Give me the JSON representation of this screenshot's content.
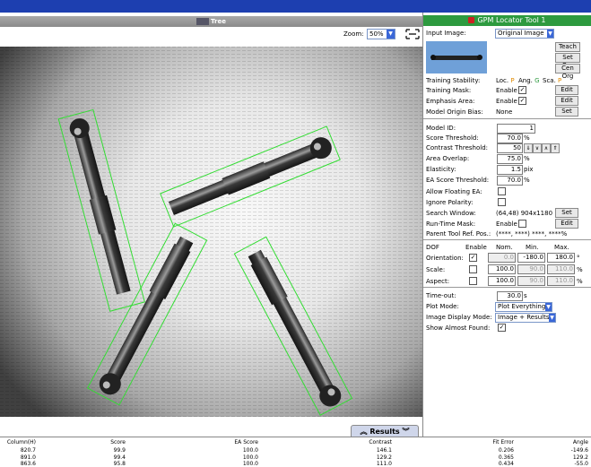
{
  "tree": {
    "title": "Tree"
  },
  "zoom": {
    "label": "Zoom:",
    "value": "50%"
  },
  "tool": {
    "title": "GPM Locator Tool 1"
  },
  "input_image": {
    "label": "Input Image:",
    "value": "Original Image"
  },
  "buttons": {
    "teach": "Teach",
    "set_org": "Set Org",
    "cen_org": "Cen Org"
  },
  "stability": {
    "label": "Training Stability:",
    "loc": "Loc.",
    "loc_v": "P",
    "ang": "Ang.",
    "ang_v": "G",
    "sca": "Sca.",
    "sca_v": "P"
  },
  "training_mask": {
    "label": "Training Mask:",
    "enable": "Enable",
    "button": "Edit"
  },
  "emphasis": {
    "label": "Emphasis Area:",
    "enable": "Enable",
    "button": "Edit"
  },
  "origin_bias": {
    "label": "Model Origin Bias:",
    "value": "None",
    "button": "Set"
  },
  "model_id": {
    "label": "Model ID:",
    "value": "1"
  },
  "score_thr": {
    "label": "Score Threshold:",
    "value": "70.0",
    "unit": "%"
  },
  "contrast_thr": {
    "label": "Contrast Threshold:",
    "value": "50"
  },
  "area_overlap": {
    "label": "Area Overlap:",
    "value": "75.0",
    "unit": "%"
  },
  "elasticity": {
    "label": "Elasticity:",
    "value": "1.5",
    "unit": "pix"
  },
  "ea_score": {
    "label": "EA Score Threshold:",
    "value": "70.0",
    "unit": "%"
  },
  "floating_ea": {
    "label": "Allow Floating EA:"
  },
  "ignore_pol": {
    "label": "Ignore Polarity:"
  },
  "search_window": {
    "label": "Search Window:",
    "value": "(64,48) 904x1180",
    "button": "Set"
  },
  "runtime_mask": {
    "label": "Run-Time Mask:",
    "enable": "Enable",
    "button": "Edit"
  },
  "parent_ref": {
    "label": "Parent Tool Ref. Pos.:",
    "value": "(****, ****) ****, ****%"
  },
  "dof": {
    "header": {
      "dof": "DOF",
      "enable": "Enable",
      "nom": "Nom.",
      "min": "Min.",
      "max": "Max."
    },
    "rows": [
      {
        "label": "Orientation:",
        "checked": "✓",
        "nom": "0.0",
        "min": "-180.0",
        "max": "180.0",
        "unit": "°"
      },
      {
        "label": "Scale:",
        "checked": "",
        "nom": "100.0",
        "min": "90.0",
        "max": "110.0",
        "unit": "%"
      },
      {
        "label": "Aspect:",
        "checked": "",
        "nom": "100.0",
        "min": "90.0",
        "max": "110.0",
        "unit": "%"
      }
    ]
  },
  "timeout": {
    "label": "Time-out:",
    "value": "30.0",
    "unit": "s"
  },
  "plot_mode": {
    "label": "Plot Mode:",
    "value": "Plot Everything"
  },
  "display_mode": {
    "label": "Image Display Mode:",
    "value": "Image + Results"
  },
  "almost_found": {
    "label": "Show Almost Found:"
  },
  "results": {
    "tab": "Results",
    "columns": [
      "Column(H)",
      "Score",
      "EA Score",
      "Contrast",
      "Fit Error",
      "Angle"
    ],
    "rows": [
      [
        "820.7",
        "99.9",
        "100.0",
        "146.1",
        "0.206",
        "-149.6"
      ],
      [
        "891.0",
        "99.4",
        "100.0",
        "129.2",
        "0.365",
        "129.2"
      ],
      [
        "863.6",
        "95.8",
        "100.0",
        "111.0",
        "0.434",
        "-55.0"
      ]
    ]
  },
  "colors": {
    "title_green": "#2d9a3f",
    "top_blue": "#1d3fb0",
    "detect_green": "#33dd33"
  }
}
